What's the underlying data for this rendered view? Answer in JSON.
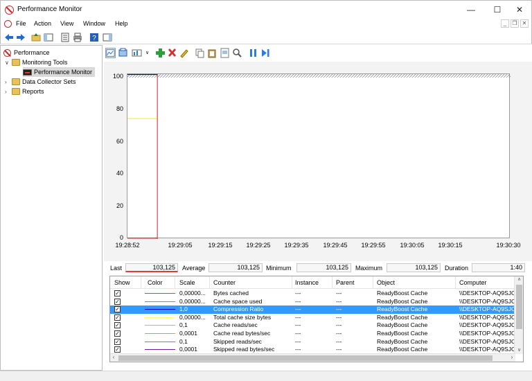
{
  "window": {
    "title": "Performance Monitor",
    "min": "—",
    "max": "☐",
    "close": "✕"
  },
  "menu": [
    "File",
    "Action",
    "View",
    "Window",
    "Help"
  ],
  "mdi": {
    "min": "_",
    "restore": "❐",
    "close": "✕"
  },
  "tree": {
    "root": "Performance",
    "monitoring_tools": "Monitoring Tools",
    "performance_monitor": "Performance Monitor",
    "data_collector_sets": "Data Collector Sets",
    "reports": "Reports"
  },
  "chart_data": {
    "type": "line",
    "ylim": [
      0,
      100
    ],
    "yticks": [
      "100",
      "80",
      "60",
      "40",
      "20",
      "0"
    ],
    "xtick_labels": [
      "19:28:52",
      "19:29:05",
      "19:29:15",
      "19:29:25",
      "19:29:35",
      "19:29:45",
      "19:29:55",
      "19:30:05",
      "19:30:15",
      "19:30:30"
    ],
    "series": [
      {
        "color": "#ffff00",
        "y": 73,
        "x_end": 0.078
      },
      {
        "color": "#0000cc",
        "y": 101,
        "x_end": 0.078
      },
      {
        "color": "#ff0000",
        "y": 0.5,
        "x_end": 0.078
      }
    ],
    "time_bar_at": 0.078
  },
  "stats": {
    "last_label": "Last",
    "last_value": "103,125",
    "average_label": "Average",
    "average_value": "103,125",
    "minimum_label": "Minimum",
    "minimum_value": "103,125",
    "maximum_label": "Maximum",
    "maximum_value": "103,125",
    "duration_label": "Duration",
    "duration_value": "1:40"
  },
  "grid": {
    "headers": [
      "Show",
      "Color",
      "Scale",
      "Counter",
      "Instance",
      "Parent",
      "Object",
      "Computer"
    ],
    "rows": [
      {
        "color": "#e53935",
        "scale": "0,00000...",
        "counter": "Bytes cached",
        "instance": "---",
        "parent": "---",
        "object": "ReadyBoost Cache",
        "computer": "\\\\DESKTOP-AQ9SJC"
      },
      {
        "color": "#4caf50",
        "scale": "0,00000...",
        "counter": "Cache space used",
        "instance": "---",
        "parent": "---",
        "object": "ReadyBoost Cache",
        "computer": "\\\\DESKTOP-AQ9SJC"
      },
      {
        "color": "#0000cc",
        "scale": "1,0",
        "counter": "Compression Ratio",
        "instance": "---",
        "parent": "---",
        "object": "ReadyBoost Cache",
        "computer": "\\\\DESKTOP-AQ9SJC",
        "selected": true
      },
      {
        "color": "#ffff66",
        "scale": "0,00000...",
        "counter": "Total cache size bytes",
        "instance": "---",
        "parent": "---",
        "object": "ReadyBoost Cache",
        "computer": "\\\\DESKTOP-AQ9SJC"
      },
      {
        "color": "#e896b8",
        "scale": "0,1",
        "counter": "Cache reads/sec",
        "instance": "---",
        "parent": "---",
        "object": "ReadyBoost Cache",
        "computer": "\\\\DESKTOP-AQ9SJC"
      },
      {
        "color": "#5bb8e0",
        "scale": "0,0001",
        "counter": "Cache read bytes/sec",
        "instance": "---",
        "parent": "---",
        "object": "ReadyBoost Cache",
        "computer": "\\\\DESKTOP-AQ9SJC"
      },
      {
        "color": "#ff33ff",
        "scale": "0,1",
        "counter": "Skipped reads/sec",
        "instance": "---",
        "parent": "---",
        "object": "ReadyBoost Cache",
        "computer": "\\\\DESKTOP-AQ9SJC"
      },
      {
        "color": "#6a1b9a",
        "scale": "0,0001",
        "counter": "Skipped read bytes/sec",
        "instance": "---",
        "parent": "---",
        "object": "ReadyBoost Cache",
        "computer": "\\\\DESKTOP-AQ9SJC"
      }
    ]
  },
  "icons": {
    "checkbox_checked": "✓",
    "chevron_down": "∨",
    "chevron_right": "›",
    "up_arrow": "∧",
    "down_arrow": "∨",
    "left_arrow": "‹",
    "right_arrow": "›"
  }
}
